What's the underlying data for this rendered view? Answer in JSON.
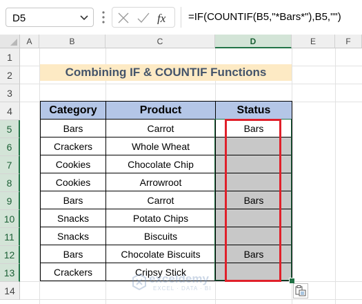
{
  "formula_bar": {
    "name_box": "D5",
    "formula": "=IF(COUNTIF(B5,\"*Bars*\"),B5,\"\")",
    "icons": [
      "cancel-icon",
      "enter-icon",
      "insert-function-icon"
    ]
  },
  "columns": [
    "A",
    "B",
    "C",
    "D",
    "E",
    "F"
  ],
  "rows": [
    "1",
    "2",
    "3",
    "4",
    "5",
    "6",
    "7",
    "8",
    "9",
    "10",
    "11",
    "12",
    "13",
    "14"
  ],
  "selected": {
    "column": "D",
    "rows": [
      "5",
      "6",
      "7",
      "8",
      "9",
      "10",
      "11",
      "12",
      "13"
    ]
  },
  "title": "Combining IF & COUNTIF Functions",
  "table": {
    "headers": {
      "category": "Category",
      "product": "Product",
      "status": "Status"
    },
    "rows": [
      {
        "category": "Bars",
        "product": "Carrot",
        "status": "Bars"
      },
      {
        "category": "Crackers",
        "product": "Whole Wheat",
        "status": ""
      },
      {
        "category": "Cookies",
        "product": "Chocolate Chip",
        "status": ""
      },
      {
        "category": "Cookies",
        "product": "Arrowroot",
        "status": ""
      },
      {
        "category": "Bars",
        "product": "Carrot",
        "status": "Bars"
      },
      {
        "category": "Snacks",
        "product": "Potato Chips",
        "status": ""
      },
      {
        "category": "Snacks",
        "product": "Biscuits",
        "status": ""
      },
      {
        "category": "Bars",
        "product": "Chocolate Biscuits",
        "status": "Bars"
      },
      {
        "category": "Crackers",
        "product": "Cripsy Stick",
        "status": ""
      }
    ]
  },
  "watermark": {
    "name": "exceldemy",
    "tagline": "EXCEL · DATA · BI"
  },
  "colors": {
    "header_fill": "#b4c6e7",
    "title_fill": "#fdeac4",
    "title_text": "#44546a",
    "selection": "#217346",
    "highlight_box": "#e0202a",
    "status_fill": "#c8c8c8"
  }
}
